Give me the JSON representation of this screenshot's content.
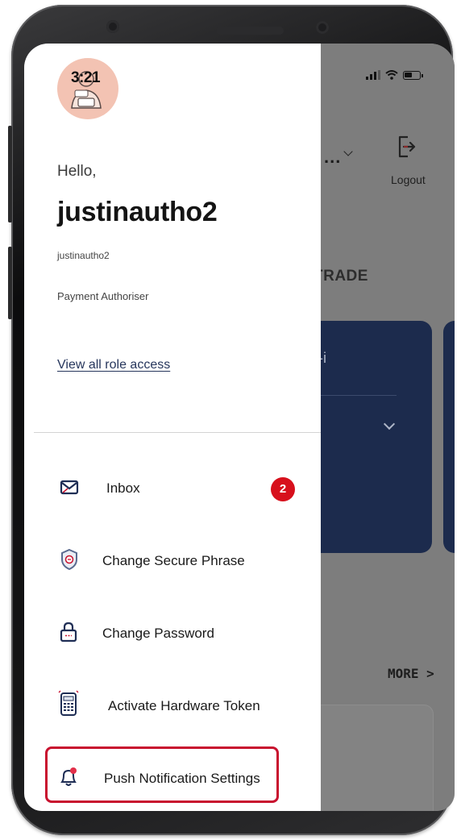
{
  "status_bar": {
    "time": "3:21"
  },
  "drawer": {
    "greeting": "Hello,",
    "display_name": "justinautho2",
    "username": "justinautho2",
    "role": "Payment Authoriser",
    "view_roles_link": "View all role access",
    "menu": [
      {
        "label": "Inbox",
        "icon": "envelope-icon",
        "badge": "2"
      },
      {
        "label": "Change Secure Phrase",
        "icon": "shield-icon"
      },
      {
        "label": "Change Password",
        "icon": "lock-icon"
      },
      {
        "label": "Activate Hardware Token",
        "icon": "hardware-token-icon"
      },
      {
        "label": "Push Notification Settings",
        "icon": "bell-icon",
        "highlighted": true
      }
    ]
  },
  "background_app": {
    "account_selector": "...",
    "logout_label": "Logout",
    "section_label": "TRADE",
    "card_text": "t-i",
    "more_link": "MORE >"
  },
  "colors": {
    "accent_navy": "#1c2b4d",
    "badge_red": "#d7101c",
    "highlight_red": "#c8102e",
    "overlay_gray": "#7d7d7d"
  }
}
